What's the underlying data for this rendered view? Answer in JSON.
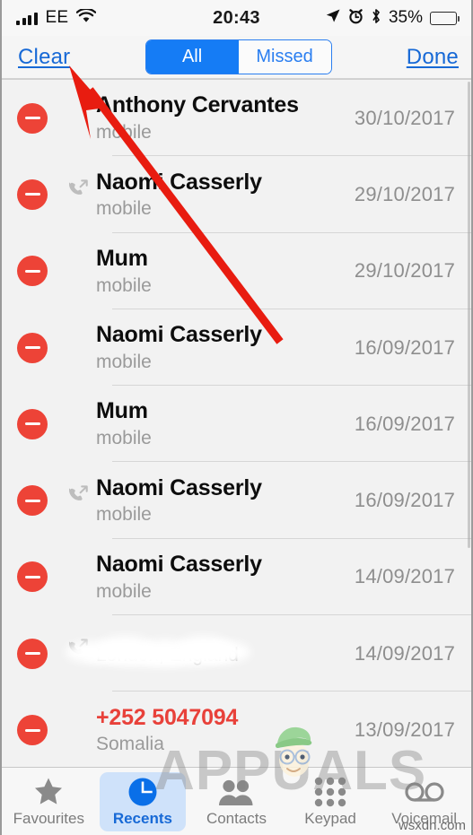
{
  "status_bar": {
    "carrier": "EE",
    "time": "20:43",
    "battery_percent": "35%",
    "icons": [
      "signal-bars-icon",
      "wifi-icon",
      "location-arrow-icon",
      "alarm-clock-icon",
      "bluetooth-icon",
      "battery-icon"
    ]
  },
  "nav_bar": {
    "clear_label": "Clear",
    "done_label": "Done",
    "segments": [
      {
        "label": "All",
        "active": true
      },
      {
        "label": "Missed",
        "active": false
      }
    ]
  },
  "calls": [
    {
      "name": "Anthony Cervantes",
      "sub": "mobile",
      "date": "30/10/2017",
      "missed": false,
      "call_type": "none",
      "redacted": false
    },
    {
      "name": "Naomi Casserly",
      "sub": "mobile",
      "date": "29/10/2017",
      "missed": false,
      "call_type": "outgoing",
      "redacted": false
    },
    {
      "name": "Mum",
      "sub": "mobile",
      "date": "29/10/2017",
      "missed": false,
      "call_type": "none",
      "redacted": false
    },
    {
      "name": "Naomi Casserly",
      "sub": "mobile",
      "date": "16/09/2017",
      "missed": false,
      "call_type": "none",
      "redacted": false
    },
    {
      "name": "Mum",
      "sub": "mobile",
      "date": "16/09/2017",
      "missed": false,
      "call_type": "none",
      "redacted": false
    },
    {
      "name": "Naomi Casserly",
      "sub": "mobile",
      "date": "16/09/2017",
      "missed": false,
      "call_type": "outgoing",
      "redacted": false
    },
    {
      "name": "Naomi Casserly",
      "sub": "mobile",
      "date": "14/09/2017",
      "missed": false,
      "call_type": "none",
      "redacted": false
    },
    {
      "name": "",
      "sub": "London, England",
      "date": "14/09/2017",
      "missed": false,
      "call_type": "outgoing",
      "redacted": true
    },
    {
      "name": "+252 5047094",
      "sub": "Somalia",
      "date": "13/09/2017",
      "missed": true,
      "call_type": "none",
      "redacted": false
    }
  ],
  "tab_bar": {
    "tabs": [
      {
        "label": "Favourites",
        "icon": "star-icon",
        "active": false
      },
      {
        "label": "Recents",
        "icon": "clock-icon",
        "active": true
      },
      {
        "label": "Contacts",
        "icon": "people-icon",
        "active": false
      },
      {
        "label": "Keypad",
        "icon": "keypad-icon",
        "active": false
      },
      {
        "label": "Voicemail",
        "icon": "voicemail-icon",
        "active": false
      }
    ]
  },
  "watermarks": {
    "brand": "APPUALS",
    "site": "wsxdn.com"
  },
  "colors": {
    "accent_blue": "#157cf5",
    "link_blue": "#1769d6",
    "delete_red": "#ed4337",
    "missed_red": "#e8413a",
    "annotation_red": "#e81c10"
  }
}
